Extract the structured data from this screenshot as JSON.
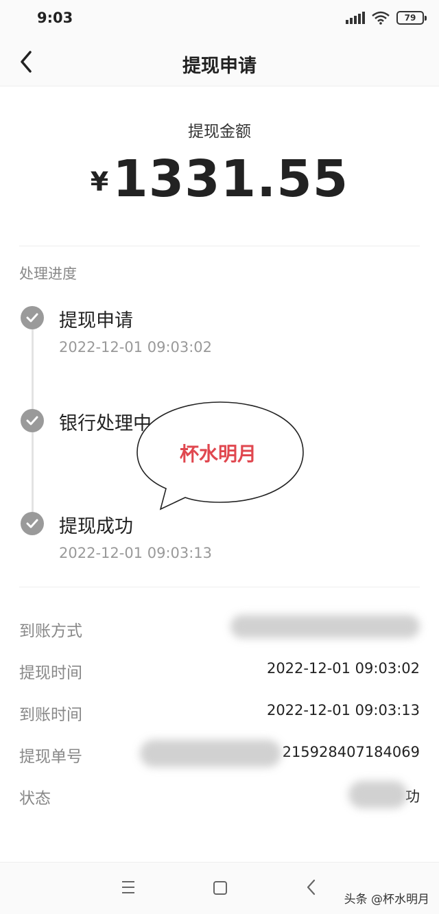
{
  "status_bar": {
    "time": "9:03",
    "battery": "79"
  },
  "nav": {
    "title": "提现申请"
  },
  "amount": {
    "label": "提现金额",
    "currency": "¥",
    "value": "1331.55"
  },
  "progress": {
    "title": "处理进度",
    "steps": [
      {
        "title": "提现申请",
        "time": "2022-12-01 09:03:02"
      },
      {
        "title": "银行处理中",
        "time": ""
      },
      {
        "title": "提现成功",
        "time": "2022-12-01 09:03:13"
      }
    ]
  },
  "bubble": {
    "text": "杯水明月"
  },
  "details": [
    {
      "label": "到账方式",
      "value": ""
    },
    {
      "label": "提现时间",
      "value": "2022-12-01 09:03:02"
    },
    {
      "label": "到账时间",
      "value": "2022-12-01 09:03:13"
    },
    {
      "label": "提现单号",
      "value": "215928407184069"
    },
    {
      "label": "状态",
      "value": "功"
    }
  ],
  "watermark": "头条 @杯水明月",
  "icons": {
    "back": "chevron-left-icon",
    "step_done": "check-circle-icon",
    "menu": "menu-icon",
    "home": "home-square-icon",
    "sys_back": "chevron-left-icon"
  },
  "colors": {
    "bubble_text": "#e0474f",
    "step_dot": "#9a9a9a"
  }
}
